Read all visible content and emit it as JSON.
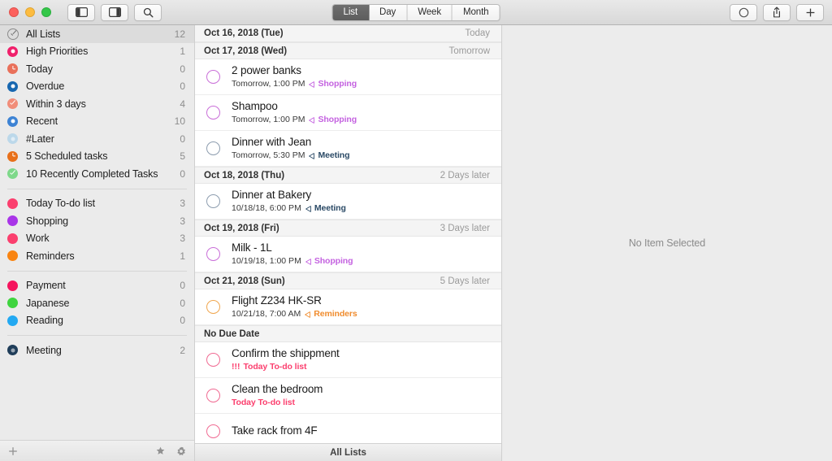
{
  "window": {
    "traffic_lights": [
      "close",
      "minimize",
      "zoom"
    ],
    "toolbar_left": [
      {
        "name": "toggle-left-sidebar",
        "icon": "panel-left-icon"
      },
      {
        "name": "toggle-right-panel",
        "icon": "panel-right-icon"
      },
      {
        "name": "search",
        "icon": "search-icon"
      }
    ],
    "toolbar_right": [
      {
        "name": "circle-button",
        "icon": "circle-icon"
      },
      {
        "name": "share-button",
        "icon": "share-icon"
      },
      {
        "name": "add-button",
        "icon": "plus-icon"
      }
    ]
  },
  "view_switcher": {
    "options": [
      "List",
      "Day",
      "Week",
      "Month"
    ],
    "selected": "List"
  },
  "sidebar": {
    "smart_lists": [
      {
        "label": "All Lists",
        "count": "12",
        "icon": "checkmark-circle-icon",
        "color": "#8b8b8b",
        "selected": true,
        "style": "check"
      },
      {
        "label": "High Priorities",
        "count": "1",
        "icon": "ring-icon",
        "color": "#f0206b",
        "style": "ring"
      },
      {
        "label": "Today",
        "count": "0",
        "icon": "clock-icon",
        "color": "#e9705a",
        "style": "clock"
      },
      {
        "label": "Overdue",
        "count": "0",
        "icon": "ring-icon",
        "color": "#1767b0",
        "style": "ring"
      },
      {
        "label": "Within 3 days",
        "count": "4",
        "icon": "check-circle-icon",
        "color": "#f18d79",
        "style": "tick"
      },
      {
        "label": "Recent",
        "count": "10",
        "icon": "ring-icon",
        "color": "#3d83d4",
        "style": "ring"
      },
      {
        "label": "#Later",
        "count": "0",
        "icon": "ring-icon",
        "color": "#bcd8ea",
        "style": "ringdark"
      },
      {
        "label": "5 Scheduled tasks",
        "count": "5",
        "icon": "clock-icon",
        "color": "#e8701a",
        "style": "clock"
      },
      {
        "label": "10 Recently Completed Tasks",
        "count": "0",
        "icon": "check-circle-icon",
        "color": "#7ed88a",
        "style": "tick"
      }
    ],
    "group_lists": [
      {
        "label": "Today To-do list",
        "count": "3",
        "icon": "list-dot-icon",
        "color": "#fb3f6e"
      },
      {
        "label": "Shopping",
        "count": "3",
        "icon": "list-dot-icon",
        "color": "#a935e8"
      },
      {
        "label": "Work",
        "count": "3",
        "icon": "list-dot-icon",
        "color": "#fb3f6e"
      },
      {
        "label": "Reminders",
        "count": "1",
        "icon": "list-dot-icon",
        "color": "#f98411"
      }
    ],
    "group_projects": [
      {
        "label": "Payment",
        "count": "0",
        "icon": "list-dot-icon",
        "color": "#f5145e"
      },
      {
        "label": "Japanese",
        "count": "0",
        "icon": "list-dot-icon",
        "color": "#3fd43f"
      },
      {
        "label": "Reading",
        "count": "0",
        "icon": "list-dot-icon",
        "color": "#23a9f2"
      }
    ],
    "group_other": [
      {
        "label": "Meeting",
        "count": "2",
        "icon": "ring-icon",
        "color": "#1f3d59",
        "style": "ringdark"
      }
    ],
    "bottom_bar": {
      "add": "plus-icon",
      "star": "star-icon",
      "settings": "gear-icon"
    }
  },
  "tasklist": {
    "status_bar": "All Lists",
    "sections": [
      {
        "header": "Oct 16, 2018 (Tue)",
        "relative": "Today",
        "tasks": []
      },
      {
        "header": "Oct 17, 2018 (Wed)",
        "relative": "Tomorrow",
        "tasks": [
          {
            "title": "2 power banks",
            "time": "Tomorrow, 1:00 PM",
            "tag": "Shopping",
            "tag_color": "#c462e0",
            "check_color": "#c96ed8",
            "priority": ""
          },
          {
            "title": "Shampoo",
            "time": "Tomorrow, 1:00 PM",
            "tag": "Shopping",
            "tag_color": "#c462e0",
            "check_color": "#c96ed8",
            "priority": ""
          },
          {
            "title": "Dinner with Jean",
            "time": "Tomorrow, 5:30 PM",
            "tag": "Meeting",
            "tag_color": "#2b4a66",
            "check_color": "#8c9cae",
            "priority": ""
          }
        ]
      },
      {
        "header": "Oct 18, 2018 (Thu)",
        "relative": "2 Days later",
        "tasks": [
          {
            "title": "Dinner at Bakery",
            "time": "10/18/18, 6:00 PM",
            "tag": "Meeting",
            "tag_color": "#2b4a66",
            "check_color": "#8c9cae",
            "priority": ""
          }
        ]
      },
      {
        "header": "Oct 19, 2018 (Fri)",
        "relative": "3 Days later",
        "tasks": [
          {
            "title": "Milk - 1L",
            "time": "10/19/18, 1:00 PM",
            "tag": "Shopping",
            "tag_color": "#c462e0",
            "check_color": "#c96ed8",
            "priority": ""
          }
        ]
      },
      {
        "header": "Oct 21, 2018 (Sun)",
        "relative": "5 Days later",
        "tasks": [
          {
            "title": "Flight Z234 HK-SR",
            "time": "10/21/18, 7:00 AM",
            "tag": "Reminders",
            "tag_color": "#f08c2e",
            "check_color": "#f0a64e",
            "priority": ""
          }
        ]
      },
      {
        "header": "No Due Date",
        "relative": "",
        "tasks": [
          {
            "title": "Confirm the shippment",
            "time": "",
            "tag": "Today To-do list",
            "tag_color": "#fb3f6e",
            "check_color": "#f06a92",
            "priority": "!!!"
          },
          {
            "title": "Clean the bedroom",
            "time": "",
            "tag": "Today To-do list",
            "tag_color": "#fb3f6e",
            "check_color": "#f06a92",
            "priority": ""
          },
          {
            "title": "Take rack from 4F",
            "time": "",
            "tag": "",
            "tag_color": "#fb3f6e",
            "check_color": "#f06a92",
            "priority": ""
          }
        ]
      }
    ]
  },
  "detail": {
    "empty_message": "No Item Selected"
  }
}
